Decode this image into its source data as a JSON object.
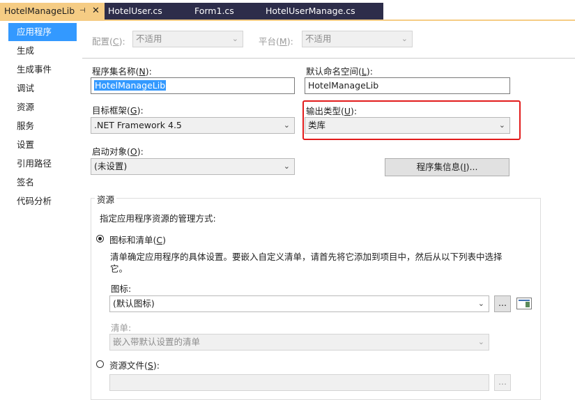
{
  "tabs": [
    {
      "label": "HotelManageLib",
      "active": true
    },
    {
      "label": "HotelUser.cs",
      "active": false
    },
    {
      "label": "Form1.cs",
      "active": false
    },
    {
      "label": "HotelUserManage.cs",
      "active": false
    }
  ],
  "tab_pin_glyph": "⊣",
  "tab_close_glyph": "✕",
  "nav": [
    {
      "label": "应用程序",
      "selected": true
    },
    {
      "label": "生成"
    },
    {
      "label": "生成事件"
    },
    {
      "label": "调试"
    },
    {
      "label": "资源"
    },
    {
      "label": "服务"
    },
    {
      "label": "设置"
    },
    {
      "label": "引用路径"
    },
    {
      "label": "签名"
    },
    {
      "label": "代码分析"
    }
  ],
  "config": {
    "config_label_pre": "配置(",
    "config_key": "C",
    "config_label_post": "):",
    "config_value": "不适用",
    "platform_label_pre": "平台(",
    "platform_key": "M",
    "platform_label_post": "):",
    "platform_value": "不适用"
  },
  "assembly_name": {
    "label_pre": "程序集名称(",
    "key": "N",
    "label_post": "):",
    "value": "HotelManageLib"
  },
  "default_namespace": {
    "label_pre": "默认命名空间(",
    "key": "L",
    "label_post": "):",
    "value": "HotelManageLib"
  },
  "target_framework": {
    "label_pre": "目标框架(",
    "key": "G",
    "label_post": "):",
    "value": ".NET Framework 4.5"
  },
  "output_type": {
    "label_pre": "输出类型(",
    "key": "U",
    "label_post": "):",
    "value": "类库"
  },
  "startup_object": {
    "label_pre": "启动对象(",
    "key": "O",
    "label_post": "):",
    "value": "(未设置)"
  },
  "assembly_info_button": {
    "label_pre": "程序集信息(",
    "key": "I",
    "label_post": ")..."
  },
  "resources": {
    "group_title": "资源",
    "description": "指定应用程序资源的管理方式:",
    "icon_manifest_radio_pre": "图标和清单(",
    "icon_manifest_radio_key": "C",
    "icon_manifest_radio_post": ")",
    "icon_manifest_help_1": "清单确定应用程序的具体设置。要嵌入自定义清单，请首先将它添加到项目中，然后从以下列表中选择",
    "icon_manifest_help_2": "它。",
    "icon_label": "图标:",
    "icon_value": "(默认图标)",
    "browse_label": "...",
    "manifest_label": "清单:",
    "manifest_value": "嵌入带默认设置的清单",
    "resource_file_radio_pre": "资源文件(",
    "resource_file_radio_key": "S",
    "resource_file_radio_post": "):",
    "resource_file_value": "",
    "resource_browse_label": "..."
  },
  "colors": {
    "accent_tab": "#f5cc84",
    "selection": "#3399ff",
    "highlight_box": "#e21b1b"
  }
}
